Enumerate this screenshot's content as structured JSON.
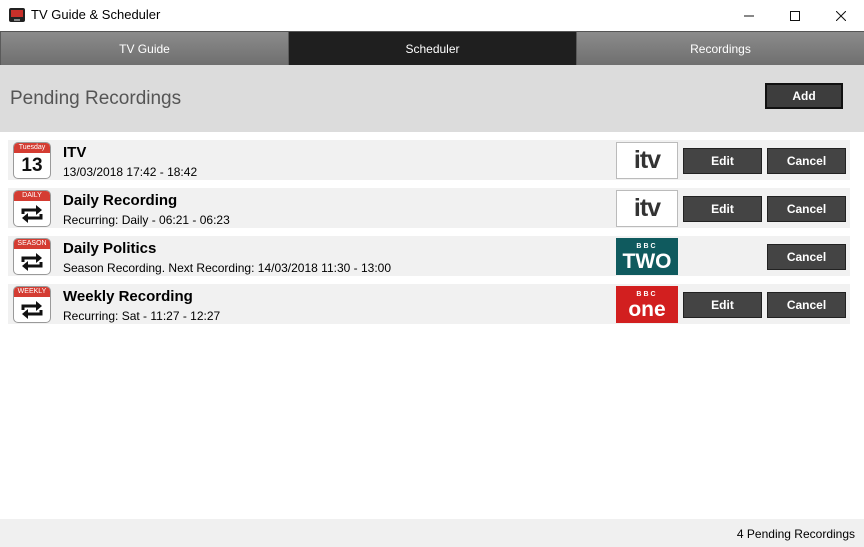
{
  "window": {
    "title": "TV Guide & Scheduler"
  },
  "tabs": [
    {
      "label": "TV Guide",
      "active": false
    },
    {
      "label": "Scheduler",
      "active": true
    },
    {
      "label": "Recordings",
      "active": false
    }
  ],
  "header": {
    "title": "Pending Recordings",
    "add_label": "Add"
  },
  "recordings": [
    {
      "cal_top": "Tuesday",
      "cal_body": "13",
      "cal_icon": "calendar-icon",
      "title": "ITV",
      "subtitle": "13/03/2018 17:42 - 18:42",
      "channel": "itv",
      "channel_logo": "itv-logo",
      "edit_label": "Edit",
      "cancel_label": "Cancel"
    },
    {
      "cal_top": "DAILY",
      "cal_icon": "repeat-icon",
      "title": "Daily Recording",
      "subtitle": "Recurring: Daily - 06:21 - 06:23",
      "channel": "itv",
      "channel_logo": "itv-logo",
      "edit_label": "Edit",
      "cancel_label": "Cancel"
    },
    {
      "cal_top": "SEASON",
      "cal_icon": "repeat-icon",
      "title": "Daily Politics",
      "subtitle": "Season Recording. Next Recording: 14/03/2018 11:30 - 13:00",
      "channel_bbc": "BBC",
      "channel": "TWO",
      "channel_logo": "bbc-two-logo",
      "cancel_label": "Cancel"
    },
    {
      "cal_top": "WEEKLY",
      "cal_icon": "repeat-icon",
      "title": "Weekly Recording",
      "subtitle": "Recurring: Sat - 11:27 - 12:27",
      "channel_bbc": "BBC",
      "channel": "one",
      "channel_logo": "bbc-one-logo",
      "edit_label": "Edit",
      "cancel_label": "Cancel"
    }
  ],
  "status": {
    "text": "4 Pending Recordings"
  },
  "colors": {
    "tab_active": "#1f1f1f",
    "calendar_red": "#d43c32",
    "bbc_two": "#0f5a5e",
    "bbc_one": "#d21f1f"
  }
}
